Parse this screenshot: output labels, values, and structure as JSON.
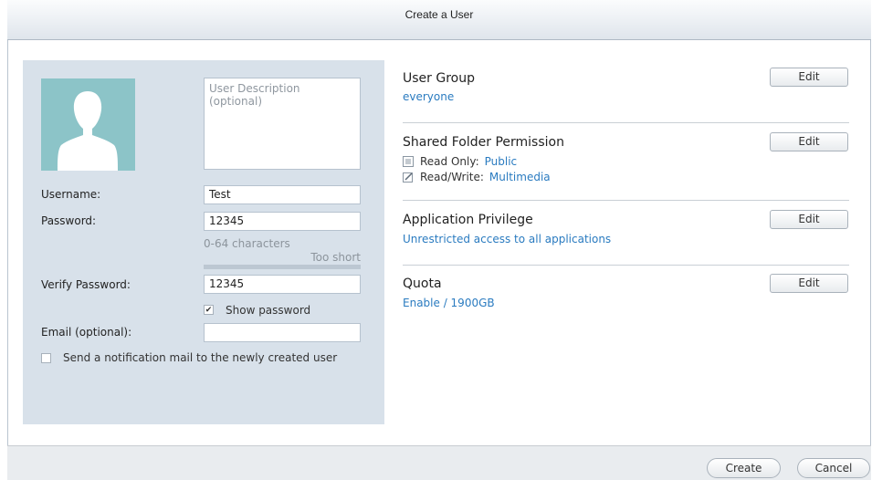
{
  "window": {
    "title": "Create a User"
  },
  "profile": {
    "description_placeholder": "User Description (optional)",
    "avatar_icon": "user-silhouette-icon"
  },
  "form": {
    "username": {
      "label": "Username:",
      "value": "Test"
    },
    "password": {
      "label": "Password:",
      "value": "12345",
      "hint": "0-64 characters",
      "strength": "Too short"
    },
    "verify_password": {
      "label": "Verify Password:",
      "value": "12345"
    },
    "show_password": {
      "label": "Show password",
      "checked": true
    },
    "email": {
      "label": "Email (optional):",
      "value": ""
    },
    "notify": {
      "label": "Send a notification mail to the newly created user",
      "checked": false
    }
  },
  "sections": {
    "user_group": {
      "title": "User Group",
      "value": "everyone",
      "edit_label": "Edit"
    },
    "shared_folder": {
      "title": "Shared Folder Permission",
      "edit_label": "Edit",
      "read_only": {
        "label": "Read Only:",
        "value": "Public",
        "icon": "document-icon"
      },
      "read_write": {
        "label": "Read/Write:",
        "value": "Multimedia",
        "icon": "edit-document-icon"
      }
    },
    "app_privilege": {
      "title": "Application Privilege",
      "value": "Unrestricted access to all applications",
      "edit_label": "Edit"
    },
    "quota": {
      "title": "Quota",
      "value": "Enable / 1900GB",
      "edit_label": "Edit"
    }
  },
  "footer": {
    "create_label": "Create",
    "cancel_label": "Cancel"
  },
  "colors": {
    "panel": "#d8e1ea",
    "avatar": "#8cc4c8",
    "link": "#2a7bc0"
  }
}
